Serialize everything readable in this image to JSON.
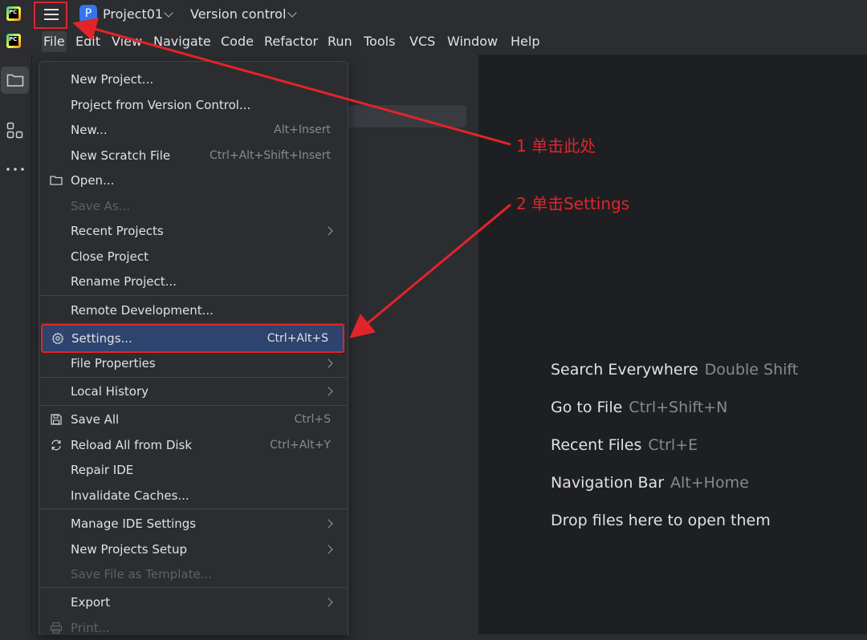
{
  "titlebar": {
    "project_badge": "P",
    "project_name": "Project01",
    "vcs_label": "Version control"
  },
  "menubar": {
    "items": [
      "File",
      "Edit",
      "View",
      "Navigate",
      "Code",
      "Refactor",
      "Run",
      "Tools",
      "VCS",
      "Window",
      "Help"
    ]
  },
  "file_menu": {
    "new_project": "New Project...",
    "project_from_vcs": "Project from Version Control...",
    "new": "New...",
    "new_shortcut": "Alt+Insert",
    "new_scratch": "New Scratch File",
    "new_scratch_shortcut": "Ctrl+Alt+Shift+Insert",
    "open": "Open...",
    "save_as": "Save As...",
    "recent_projects": "Recent Projects",
    "close_project": "Close Project",
    "rename_project": "Rename Project...",
    "remote_dev": "Remote Development...",
    "settings": "Settings...",
    "settings_shortcut": "Ctrl+Alt+S",
    "file_properties": "File Properties",
    "local_history": "Local History",
    "save_all": "Save All",
    "save_all_shortcut": "Ctrl+S",
    "reload_all": "Reload All from Disk",
    "reload_all_shortcut": "Ctrl+Alt+Y",
    "repair_ide": "Repair IDE",
    "invalidate_caches": "Invalidate Caches...",
    "manage_ide_settings": "Manage IDE Settings",
    "new_projects_setup": "New Projects Setup",
    "save_file_template": "Save File as Template...",
    "export": "Export",
    "print": "Print..."
  },
  "editor_hints": [
    {
      "action": "Search Everywhere",
      "shortcut": "Double Shift"
    },
    {
      "action": "Go to File",
      "shortcut": "Ctrl+Shift+N"
    },
    {
      "action": "Recent Files",
      "shortcut": "Ctrl+E"
    },
    {
      "action": "Navigation Bar",
      "shortcut": "Alt+Home"
    },
    {
      "action": "Drop files here to open them",
      "shortcut": ""
    }
  ],
  "annotations": {
    "step1": "1 单击此处",
    "step2": "2 单击Settings"
  },
  "colors": {
    "annotation_red": "#e2242a",
    "selection_blue": "#2e436e",
    "project_badge_blue": "#3574f0"
  }
}
